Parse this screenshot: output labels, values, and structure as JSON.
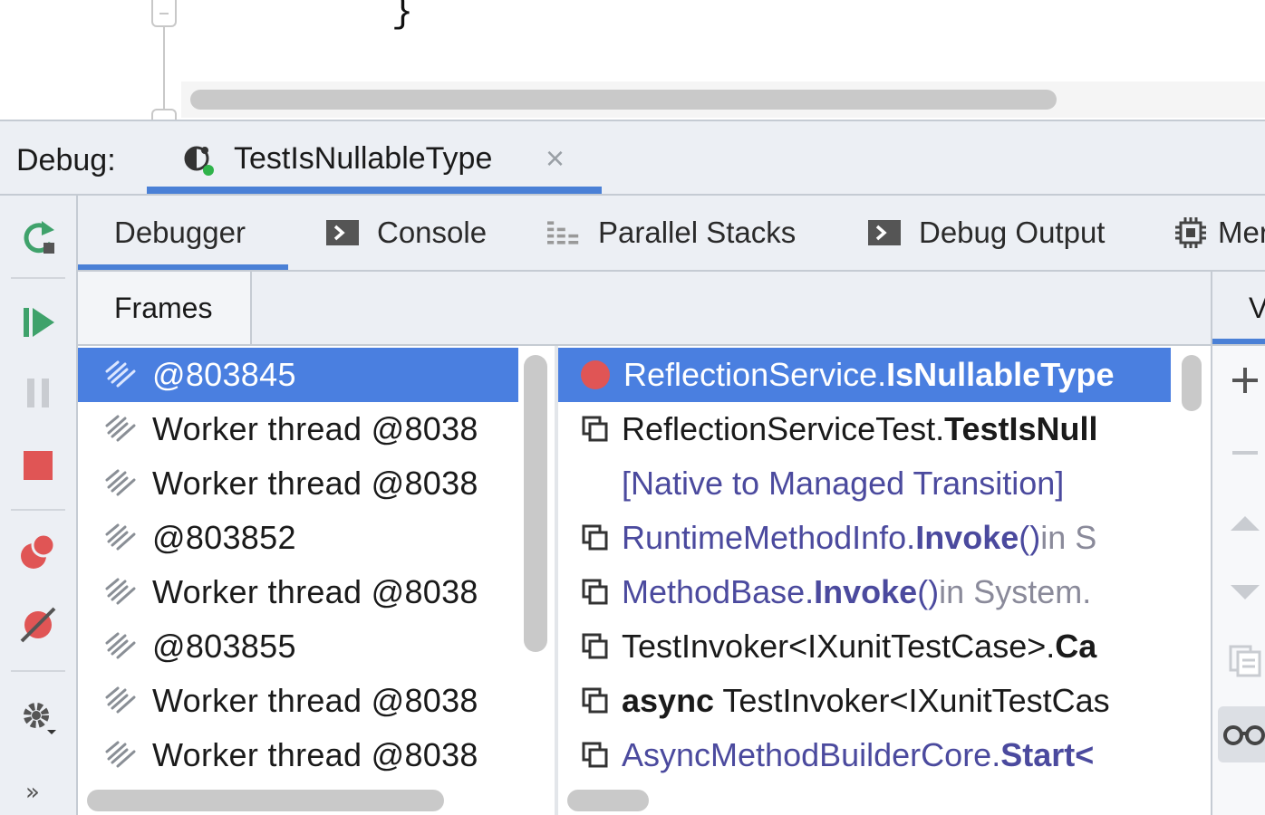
{
  "editor": {
    "code_fragment": "}"
  },
  "debug_header": {
    "label": "Debug:",
    "session_tab": {
      "name": "TestIsNullableType",
      "close_glyph": "×",
      "icon": "debug-session-icon"
    }
  },
  "toolbar_icons": [
    "rerun-icon",
    "resume-icon",
    "pause-icon",
    "stop-icon",
    "view-breakpoints-icon",
    "mute-breakpoints-icon",
    "settings-icon"
  ],
  "more_glyph": "»",
  "subtabs": [
    {
      "label": "Debugger",
      "active": true
    },
    {
      "label": "Console",
      "icon": "console-icon"
    },
    {
      "label": "Parallel Stacks",
      "icon": "parallel-stacks-icon"
    },
    {
      "label": "Debug Output",
      "icon": "console-icon"
    },
    {
      "label": "Mer",
      "icon": "memory-icon"
    }
  ],
  "frames_tab": {
    "label": "Frames"
  },
  "vars_tab": {
    "label": "V"
  },
  "threads": [
    {
      "label": " @803845",
      "selected": true
    },
    {
      "label": "Worker thread @8038"
    },
    {
      "label": "Worker thread @8038"
    },
    {
      "label": " @803852"
    },
    {
      "label": "Worker thread @8038"
    },
    {
      "label": " @803855"
    },
    {
      "label": "Worker thread @8038"
    },
    {
      "label": "Worker thread @8038"
    }
  ],
  "stack_frames": [
    {
      "pre": "ReflectionService.",
      "bold": "IsNullableType",
      "post": "",
      "icon": "breakpoint-icon",
      "style": "user",
      "selected": true
    },
    {
      "pre": "ReflectionServiceTest.",
      "bold": "TestIsNull",
      "post": "",
      "icon": "frame-icon",
      "style": "user"
    },
    {
      "pre": "[Native to Managed Transition]",
      "bold": "",
      "post": "",
      "icon": "",
      "style": "lib"
    },
    {
      "pre": "RuntimeMethodInfo.",
      "bold": "Invoke",
      "post": "()",
      "suffix": " in S",
      "icon": "frame-icon",
      "style": "lib"
    },
    {
      "pre": "MethodBase.",
      "bold": "Invoke",
      "post": "()",
      "suffix": " in System.",
      "icon": "frame-icon",
      "style": "lib"
    },
    {
      "pre": "TestInvoker<IXunitTestCase>.",
      "bold": "Ca",
      "post": "",
      "icon": "frame-icon",
      "style": "user"
    },
    {
      "lead_bold": "async",
      "pre": " TestInvoker<IXunitTestCas",
      "bold": "",
      "post": "",
      "icon": "frame-icon",
      "style": "user"
    },
    {
      "pre": "AsyncMethodBuilderCore.",
      "bold": "Start<",
      "post": "",
      "icon": "frame-icon",
      "style": "lib"
    }
  ],
  "vars_toolbar_icons": [
    "add-icon",
    "remove-icon",
    "move-up-icon",
    "move-down-icon",
    "copy-icon",
    "watches-glasses-icon"
  ],
  "colors": {
    "accent": "#4a80d6",
    "selection": "#4a7fe0",
    "library_text": "#4b4a9e",
    "stop_red": "#e05555",
    "run_green": "#3fa26b"
  }
}
